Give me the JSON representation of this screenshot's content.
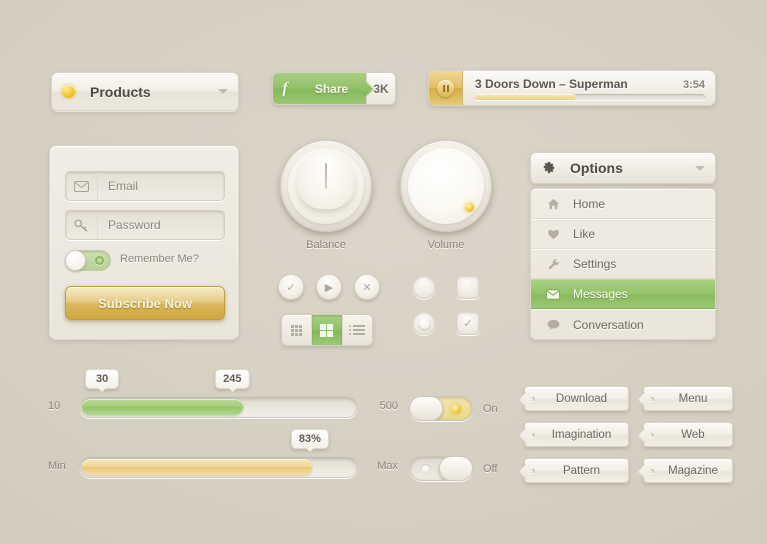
{
  "dropdown": {
    "label": "Products",
    "icon": "bulb-icon",
    "caret": "chevron-down-icon"
  },
  "share": {
    "network_icon": "facebook-f-icon",
    "label": "Share",
    "count": "3K"
  },
  "player": {
    "button_icon": "pause-icon",
    "track_title": "3 Doors Down – Superman",
    "duration": "3:54",
    "progress_percent": 44
  },
  "login": {
    "email": {
      "icon": "envelope-icon",
      "placeholder": "Email"
    },
    "password": {
      "icon": "key-icon",
      "placeholder": "Password"
    },
    "remember": {
      "label": "Remember Me?",
      "state": "on"
    },
    "subscribe_label": "Subscribe Now"
  },
  "knobs": [
    {
      "label": "Balance",
      "indicator": "line-pointer"
    },
    {
      "label": "Volume",
      "indicator": "dot-marker"
    }
  ],
  "circle_buttons": [
    {
      "icon": "check-icon",
      "glyph": "✓"
    },
    {
      "icon": "play-icon",
      "glyph": "▶"
    },
    {
      "icon": "close-icon",
      "glyph": "✕"
    }
  ],
  "segmented": {
    "items": [
      {
        "icon": "grid-small-icon",
        "active": false
      },
      {
        "icon": "grid-large-icon",
        "active": true
      },
      {
        "icon": "list-view-icon",
        "active": false
      }
    ]
  },
  "choices": [
    {
      "type": "radio",
      "checked": false,
      "name": "radio-unchecked"
    },
    {
      "type": "checkbox",
      "checked": false,
      "name": "checkbox-unchecked"
    },
    {
      "type": "radio",
      "checked": true,
      "name": "radio-checked"
    },
    {
      "type": "checkbox",
      "checked": true,
      "name": "checkbox-checked",
      "glyph": "✓"
    }
  ],
  "options": {
    "header": {
      "icon": "gear-icon",
      "title": "Options",
      "caret": "chevron-down-icon"
    },
    "items": [
      {
        "icon": "home-icon",
        "glyph": "⌂",
        "label": "Home",
        "active": false
      },
      {
        "icon": "heart-icon",
        "glyph": "♥",
        "label": "Like",
        "active": false
      },
      {
        "icon": "wrench-icon",
        "glyph": "⚒",
        "label": "Settings",
        "active": false
      },
      {
        "icon": "envelope-icon",
        "glyph": "✉",
        "label": "Messages",
        "active": true
      },
      {
        "icon": "speech-bubble-icon",
        "glyph": "●",
        "label": "Conversation",
        "active": false
      }
    ]
  },
  "sliders": [
    {
      "name": "range-slider",
      "min_label": "10",
      "max_label": "500",
      "tooltips": [
        "30",
        "245"
      ],
      "fill_percent": 58,
      "color": "#95c567"
    },
    {
      "name": "single-slider",
      "min_label": "Min",
      "max_label": "Max",
      "tooltips": [
        "83%"
      ],
      "fill_percent": 83,
      "color": "#e7c977"
    }
  ],
  "switches": [
    {
      "name": "switch-on",
      "state": "on",
      "label": "On"
    },
    {
      "name": "switch-off",
      "state": "off",
      "label": "Off"
    }
  ],
  "tag_buttons": [
    {
      "label": "Download"
    },
    {
      "label": "Menu"
    },
    {
      "label": "Imagination"
    },
    {
      "label": "Web"
    },
    {
      "label": "Pattern"
    },
    {
      "label": "Magazine"
    }
  ],
  "colors": {
    "background": "#d6d0c3",
    "panel": "#efece4",
    "green": "#95c567",
    "gold": "#d9b75c",
    "text": "#6b6459"
  }
}
